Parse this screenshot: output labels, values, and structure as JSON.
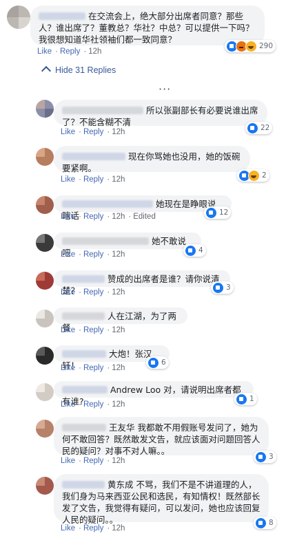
{
  "thread": {
    "hide_label": "Hide 31 Replies",
    "more_label": "···"
  },
  "actions": {
    "like": "Like",
    "reply": "Reply",
    "edited": "Edited"
  },
  "comments": [
    {
      "text": "在交流会上，绝大部分出席者同意？那些人？谁出席了？董教总？华社？中总？可以提供一下吗？我很想知道华社领袖们都一致同意？",
      "time": "12h",
      "reactions": [
        "like",
        "angry",
        "haha"
      ],
      "count": "290"
    },
    {
      "text": "所以张副部长有必要说谁出席了？不能含糊不清",
      "time": "12h",
      "reactions": [
        "like"
      ],
      "count": "22"
    },
    {
      "text": "现在你骂她也没用，她的饭碗要紧啊。",
      "time": "12h",
      "reactions": [
        "like",
        "haha"
      ],
      "count": "2"
    },
    {
      "text": "她现在是睁眼说瞎话",
      "time": "12h",
      "reactions": [
        "like"
      ],
      "count": "12",
      "edited": true
    },
    {
      "text": "她不敢说吧",
      "time": "12h",
      "reactions": [
        "like"
      ],
      "count": "4"
    },
    {
      "text": "赞成的出席者是谁？请你说清楚？",
      "time": "12h",
      "reactions": [
        "like"
      ],
      "count": "3"
    },
    {
      "text": "人在江湖，为了两餐",
      "time": "12h",
      "reactions": [],
      "count": ""
    },
    {
      "text": "大炮！张汉轩！",
      "time": "12h",
      "reactions": [
        "like"
      ],
      "count": "6"
    },
    {
      "text": "Andrew Loo 对，请说明出席者都有谁?",
      "time": "12h",
      "reactions": [
        "like"
      ],
      "count": "1"
    },
    {
      "text": "王友华 我都敢不用假账号发问了，她为何不敢回答？既然敢发文告，就应该面对问题回答人民的疑问？对事不对人嘛。。",
      "time": "12h",
      "reactions": [
        "like"
      ],
      "count": "3"
    },
    {
      "text": "黄东成 不骂，我们不是不讲道理的人，我们身为马来西亚公民和选民，有知情权！既然部长发了文告，我觉得有疑问，可以发问，她也应该回复人民的疑问。。",
      "time": "12h",
      "reactions": [
        "like"
      ],
      "count": "8"
    }
  ]
}
